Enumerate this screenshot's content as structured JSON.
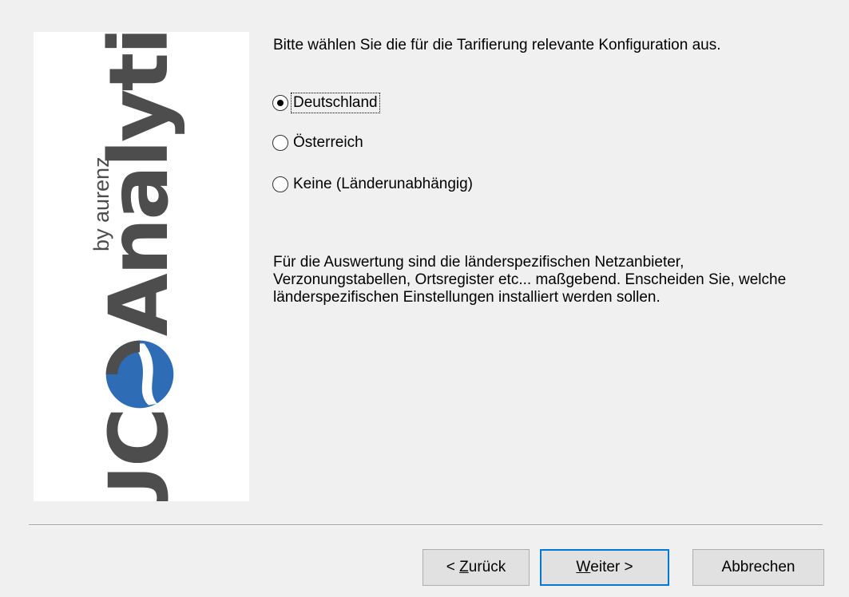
{
  "logo": {
    "main_left": "UC",
    "main_right": "Analytics",
    "sub": "by aurenz",
    "colors": {
      "text": "#4d4d4d",
      "swirl_blue": "#2e6db5",
      "swirl_gray": "#4d4d4d"
    }
  },
  "intro_text": "Bitte wählen Sie die für die Tarifierung relevante Konfiguration aus.",
  "options": [
    {
      "label": "Deutschland",
      "selected": true,
      "focused": true
    },
    {
      "label": "Österreich",
      "selected": false,
      "focused": false
    },
    {
      "label": "Keine (Länderunabhängig)",
      "selected": false,
      "focused": false
    }
  ],
  "description": "Für die Auswertung sind die länderspezifischen Netzanbieter, Verzonungstabellen, Ortsregister etc... maßgebend. Enscheiden Sie, welche länderspezifischen Einstellungen installiert werden sollen.",
  "buttons": {
    "back": {
      "prefix": "< ",
      "mnemonic": "Z",
      "rest": "urück"
    },
    "next": {
      "mnemonic": "W",
      "rest": "eiter",
      "suffix": " >"
    },
    "cancel": "Abbrechen"
  },
  "colors": {
    "dialog_bg": "#f0f0f0",
    "default_button_border": "#0078d7"
  }
}
